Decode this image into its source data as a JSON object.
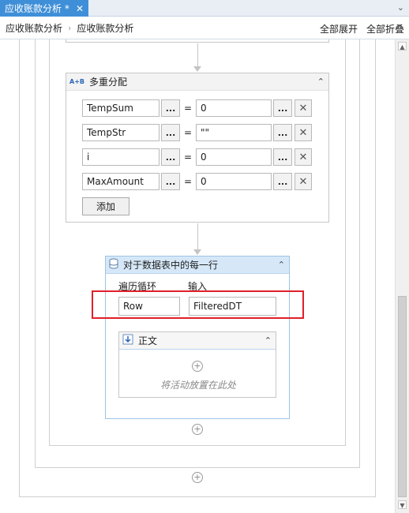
{
  "tab": {
    "title": "应收账款分析 *",
    "close": "✕",
    "dropdown": "⌄"
  },
  "breadcrumb": {
    "items": [
      "应收账款分析",
      "应收账款分析"
    ],
    "separator": "›",
    "expand_all": "全部展开",
    "collapse_all": "全部折叠"
  },
  "multi_assign": {
    "title": "多重分配",
    "icon": "A+B",
    "rows": [
      {
        "to": "TempSum",
        "value": "0"
      },
      {
        "to": "TempStr",
        "value": "\"\""
      },
      {
        "to": "i",
        "value": "0"
      },
      {
        "to": "MaxAmount",
        "value": "0"
      }
    ],
    "add_label": "添加",
    "dots": "...",
    "equals": "=",
    "delete": "✕"
  },
  "for_each": {
    "title": "对于数据表中的每一行",
    "loop_label": "遍历循环",
    "input_label": "输入",
    "loop_value": "Row",
    "input_value": "FilteredDT",
    "body": {
      "title": "正文",
      "placeholder": "将活动放置在此处"
    }
  },
  "icons": {
    "collapse": "⌃",
    "plus": "+",
    "up": "▲",
    "down": "▼"
  },
  "colors": {
    "tab_bg": "#3f8fd8",
    "foreach_header": "#d6e8f8",
    "highlight": "#e0202a"
  }
}
